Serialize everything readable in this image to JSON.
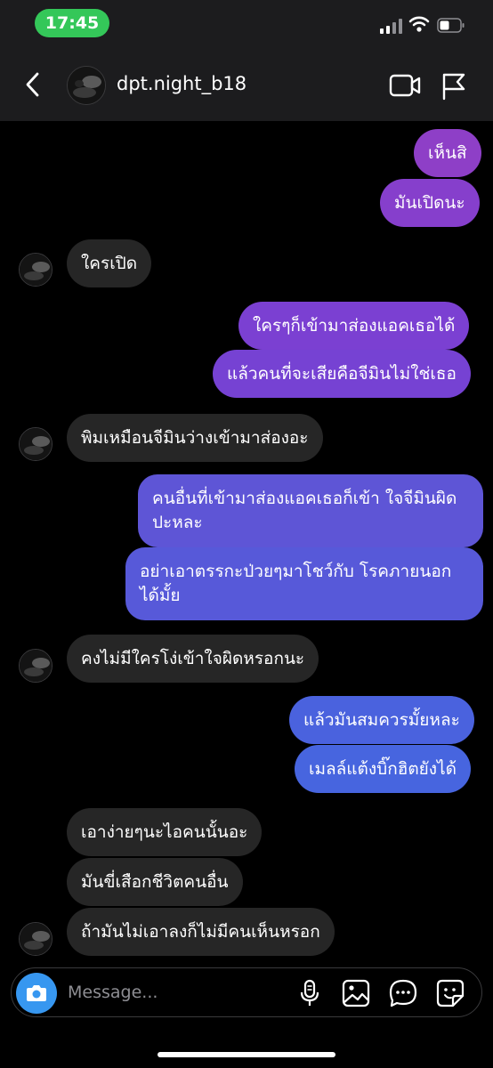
{
  "status_bar": {
    "time": "17:45"
  },
  "header": {
    "username": "dpt.night_b18"
  },
  "messages": [
    {
      "text": "เห็นสิ",
      "sender": "me",
      "bg": "#8e3fc7"
    },
    {
      "text": "มันเปิดนะ",
      "sender": "me",
      "bg": "#863fcc"
    },
    {
      "text": "ใครเปิด",
      "sender": "them"
    },
    {
      "text": "ใครๆก็เข้ามาส่องแอคเธอได้",
      "sender": "me",
      "bg": "#7b40d2"
    },
    {
      "text": "แล้วคนที่จะเสียคือจีมินไม่ใช่เธอ",
      "sender": "me",
      "bg": "#7642d3"
    },
    {
      "text": "พิมเหมือนจีมินว่างเข้ามาส่องอะ",
      "sender": "them"
    },
    {
      "text": "คนอื่นที่เข้ามาส่องแอคเธอก็เข้า ใจจีมินผิด ปะหละ",
      "sender": "me",
      "bg": "#5e55d6"
    },
    {
      "text": "อย่าเอาตรรกะป่วยๆมาโชว์กับ โรคภายนอก ได้มั้ย",
      "sender": "me",
      "bg": "#5759d9"
    },
    {
      "text": "คงไม่มีใครโง่เข้าใจผิดหรอกนะ",
      "sender": "them"
    },
    {
      "text": "แล้วมันสมควรมั้ยหละ",
      "sender": "me",
      "bg": "#4a62de"
    },
    {
      "text": "เมลล์แต้งบิ๊กฮิตยังได้",
      "sender": "me",
      "bg": "#4765df"
    },
    {
      "text": "เอาง่ายๆนะไอคนนั้นอะ",
      "sender": "them"
    },
    {
      "text": "มันขี่เสือกชีวิตคนอื่น",
      "sender": "them"
    },
    {
      "text": "ถ้ามันไม่เอาลงก็ไม่มีคนเห็นหรอก",
      "sender": "them"
    }
  ],
  "composer": {
    "placeholder": "Message..."
  },
  "colors": {
    "incoming_bubble": "#262626",
    "camera_button": "#3797f0",
    "status_time_pill": "#34c759"
  }
}
